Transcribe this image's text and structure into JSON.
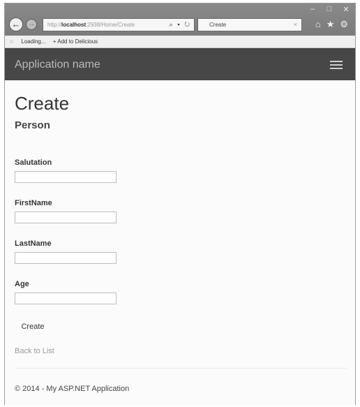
{
  "browser": {
    "address_prefix": "http://",
    "address_host": "localhost",
    "address_rest": ":2938/Home/Create",
    "address_tools": "⌕ ▾ ↻",
    "tab_title": "Create",
    "tab_close": "×",
    "favorites": {
      "loading_label": "Loading...",
      "delicious_label": "+ Add to Delicious"
    }
  },
  "app": {
    "brand": "Application name"
  },
  "page": {
    "title": "Create",
    "subtitle": "Person"
  },
  "form": {
    "fields": [
      {
        "label": "Salutation",
        "value": ""
      },
      {
        "label": "FirstName",
        "value": ""
      },
      {
        "label": "LastName",
        "value": ""
      },
      {
        "label": "Age",
        "value": ""
      }
    ],
    "submit_label": "Create"
  },
  "links": {
    "back_to_list": "Back to List"
  },
  "footer": {
    "text": "© 2014 - My ASP.NET Application"
  },
  "colors": {
    "navbar": "#474747",
    "brand_text": "#b9b9b9",
    "link": "#9a9a9a"
  }
}
